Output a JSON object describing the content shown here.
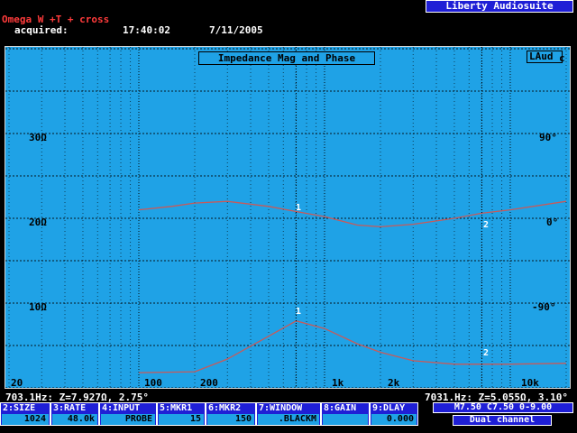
{
  "header": {
    "title": "Omega W +T + cross",
    "acquired_label": "acquired:",
    "acquired_time": "17:40:02",
    "acquired_date": "7/11/2005",
    "brand": "Liberty Audiosuite"
  },
  "chart_data": {
    "type": "line",
    "title": "Impedance Mag and Phase",
    "channel_tag": "LAud",
    "channel_suffix": "c",
    "xscale": "log",
    "xlim": [
      20,
      20000
    ],
    "x_ticks": [
      "20",
      "100",
      "200",
      "1k",
      "2k",
      "10k"
    ],
    "y_left_ticks": [
      "30Ω",
      "20Ω",
      "10Ω"
    ],
    "y_right_ticks": [
      "90°",
      "0°",
      "-90°"
    ],
    "series": [
      {
        "x": [
          100,
          200,
          300,
          500,
          703,
          1000,
          1500,
          2000,
          3000,
          5000,
          7000,
          10000,
          20000
        ],
        "values": [
          1.8,
          1.9,
          3.4,
          6.1,
          7.9,
          7.0,
          5.2,
          4.2,
          3.2,
          2.8,
          2.8,
          2.8,
          2.9
        ]
      },
      {
        "x": [
          100,
          150,
          200,
          300,
          500,
          703,
          1000,
          1500,
          2000,
          3000,
          5000,
          7000,
          10000,
          20000
        ],
        "values": [
          21.0,
          21.4,
          21.8,
          22.0,
          21.4,
          20.8,
          20.2,
          19.2,
          19.0,
          19.3,
          20.0,
          20.6,
          21.0,
          22.0
        ]
      }
    ],
    "markers": [
      {
        "label": "1",
        "x": 703
      },
      {
        "label": "2",
        "x": 7031
      }
    ]
  },
  "readouts": {
    "marker1": "703.1Hz: Z=7.927Ω, 2.75°",
    "marker2": "7031.Hz: Z=5.055Ω, 3.10°"
  },
  "keys": [
    {
      "label": "2:SIZE",
      "value": "1024"
    },
    {
      "label": "3:RATE",
      "value": "48.0k"
    },
    {
      "label": "4:INPUT",
      "value": "PROBE"
    },
    {
      "label": "5:MKR1",
      "value": "15"
    },
    {
      "label": "6:MKR2",
      "value": "150"
    },
    {
      "label": "7:WINDOW",
      "value": ".BLACKM"
    },
    {
      "label": "8:GAIN",
      "value": ""
    },
    {
      "label": "9:DLAY",
      "value": "0.000"
    }
  ],
  "status": {
    "line1": "M7.50 C7.50 0-9.00",
    "line2": "Dual channel"
  },
  "colors": {
    "plot_bg": "#1fa2e6",
    "trace": "#c85a5a",
    "grid": "#000000",
    "brand_bg": "#1f1fd6",
    "title": "#ff3b3b"
  }
}
